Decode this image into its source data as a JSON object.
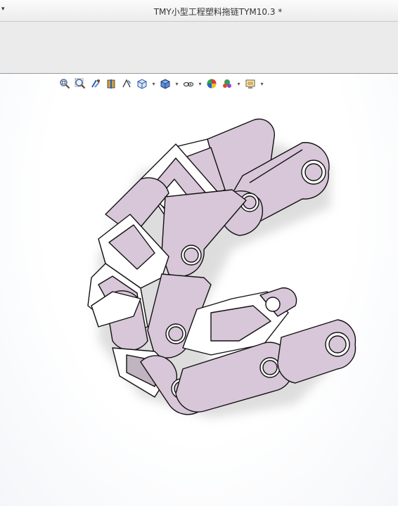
{
  "window": {
    "title": "TMY小型工程塑料拖链TYM10.3 *",
    "menu_caret": "▾"
  },
  "view_toolbar": {
    "items": [
      {
        "icon": "zoom-to-fit-icon"
      },
      {
        "icon": "zoom-to-area-icon"
      },
      {
        "icon": "previous-view-icon"
      },
      {
        "icon": "section-view-icon"
      },
      {
        "icon": "dynamic-annotation-icon"
      },
      {
        "icon": "view-orientation-icon",
        "dropdown": true
      },
      {
        "icon": "display-style-icon",
        "dropdown": true
      },
      {
        "icon": "hide-show-items-icon",
        "dropdown": true
      },
      {
        "icon": "edit-appearance-icon"
      },
      {
        "icon": "apply-scene-icon",
        "dropdown": true
      },
      {
        "icon": "view-settings-icon",
        "dropdown": true
      }
    ],
    "caret": "▾"
  },
  "model": {
    "part_color": "#d8c7d8",
    "face_color": "#ffffff",
    "edge_color": "#111111"
  }
}
